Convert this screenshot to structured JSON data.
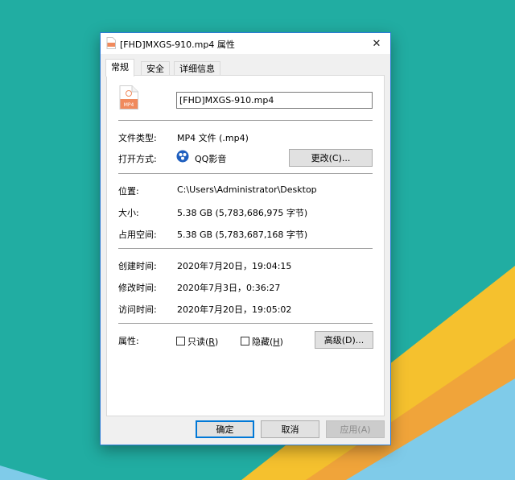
{
  "window": {
    "title": "[FHD]MXGS-910.mp4 属性",
    "close_label": "✕"
  },
  "tabs": [
    {
      "label": "常规"
    },
    {
      "label": "安全"
    },
    {
      "label": "详细信息"
    }
  ],
  "file": {
    "icon_label": "MP4",
    "name": "[FHD]MXGS-910.mp4"
  },
  "type_row": {
    "label": "文件类型:",
    "value": "MP4 文件 (.mp4)"
  },
  "open_with": {
    "label": "打开方式:",
    "app_name": "QQ影音",
    "change_button": "更改(C)..."
  },
  "location": {
    "label": "位置:",
    "value": "C:\\Users\\Administrator\\Desktop"
  },
  "size": {
    "label": "大小:",
    "value": "5.38 GB (5,783,686,975 字节)"
  },
  "size_on_disk": {
    "label": "占用空间:",
    "value": "5.38 GB (5,783,687,168 字节)"
  },
  "created": {
    "label": "创建时间:",
    "value": "2020年7月20日，19:04:15"
  },
  "modified": {
    "label": "修改时间:",
    "value": "2020年7月3日，0:36:27"
  },
  "accessed": {
    "label": "访问时间:",
    "value": "2020年7月20日，19:05:02"
  },
  "attributes": {
    "label": "属性:",
    "readonly_label": "只读",
    "readonly_key": "R",
    "hidden_label": "隐藏",
    "hidden_key": "H",
    "advanced_button": "高级(D)...",
    "readonly_checked": false,
    "hidden_checked": false
  },
  "buttons": {
    "ok": "确定",
    "cancel": "取消",
    "apply": "应用(A)"
  },
  "colors": {
    "desktop_teal": "#21ada2",
    "wallpaper_yellow": "#f5c12e",
    "wallpaper_orange": "#f0a43a",
    "wallpaper_blue": "#7fcbe9",
    "window_border": "#2b7bd6",
    "file_icon_orange": "#f08a5d"
  }
}
